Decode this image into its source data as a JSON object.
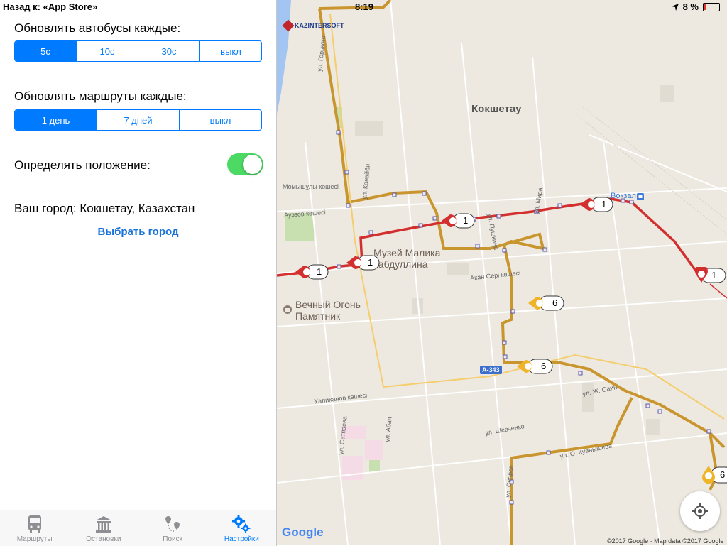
{
  "status": {
    "back_label": "Назад к: «App Store»",
    "time": "8:19",
    "battery": "8 %"
  },
  "settings": {
    "bus_refresh": {
      "label": "Обновлять автобусы каждые:",
      "options": [
        "5с",
        "10с",
        "30с",
        "выкл"
      ],
      "selected": "5с"
    },
    "route_refresh": {
      "label": "Обновлять маршруты каждые:",
      "options": [
        "1 день",
        "7 дней",
        "выкл"
      ],
      "selected": "1 день"
    },
    "location": {
      "label": "Определять положение:",
      "enabled": true
    },
    "city": {
      "label": "Ваш город: Кокшетау, Казахстан",
      "choose_label": "Выбрать город"
    }
  },
  "tabs": [
    {
      "label": "Маршруты",
      "icon": "bus-icon",
      "active": false
    },
    {
      "label": "Остановки",
      "icon": "bus-stop-icon",
      "active": false
    },
    {
      "label": "Поиск",
      "icon": "route-search-icon",
      "active": false
    },
    {
      "label": "Настройки",
      "icon": "gears-icon",
      "active": true
    }
  ],
  "map": {
    "city_label": "Кокшетау",
    "logo_text": "KAZINTERSOFT",
    "poi": [
      "Музей Малика",
      "Габдуллина",
      "Вечный Огонь",
      "Памятник",
      "Вокзал"
    ],
    "streets": [
      "ул. Горького",
      "ул. Канайби",
      "Ауэзов көшесі",
      "ул. Пушкина",
      "ул. Мира",
      "Акан Сері көшесі",
      "Уалиханов көшесі",
      "ул. Сатпаева",
      "ул. Шевченко",
      "ул. Абая",
      "ул. Ж. Саин",
      "ул. О. Куанышева",
      "Момышұлы көшесі",
      "ул. Сүгіров"
    ],
    "road_badge": "A-343",
    "bus_markers": [
      {
        "route": "1",
        "color": "#e53935"
      },
      {
        "route": "1",
        "color": "#e53935"
      },
      {
        "route": "1",
        "color": "#e53935"
      },
      {
        "route": "1",
        "color": "#e53935"
      },
      {
        "route": "1",
        "color": "#e53935"
      },
      {
        "route": "6",
        "color": "#f0b429"
      },
      {
        "route": "6",
        "color": "#f0b429"
      },
      {
        "route": "6",
        "color": "#f0b429"
      }
    ],
    "google_logo": "Google",
    "copyright": "©2017 Google · Map data ©2017 Google"
  },
  "colors": {
    "accent": "#007aff",
    "toggle_on": "#4cd964",
    "route_1": "#d32f2f",
    "route_6": "#c8962e"
  }
}
